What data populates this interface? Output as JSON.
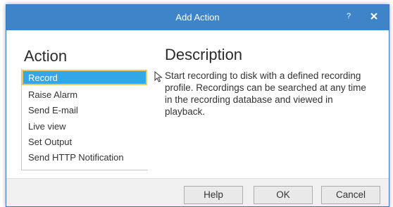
{
  "dialog": {
    "title": "Add Action",
    "help_label": "?",
    "close_icon": "close-icon"
  },
  "headings": {
    "action": "Action",
    "description": "Description"
  },
  "actions": [
    {
      "label": "Record",
      "selected": true
    },
    {
      "label": "Raise Alarm",
      "selected": false
    },
    {
      "label": "Send E-mail",
      "selected": false
    },
    {
      "label": "Live view",
      "selected": false
    },
    {
      "label": "Set Output",
      "selected": false
    },
    {
      "label": "Send HTTP Notification",
      "selected": false
    }
  ],
  "description_text": "Start recording to disk with a defined recording profile. Recordings can be searched at any time in the recording database and viewed in playback.",
  "buttons": {
    "help": "Help",
    "ok": "OK",
    "cancel": "Cancel"
  },
  "colors": {
    "titlebar": "#3f84c8",
    "selection": "#33a6e8",
    "selection_border": "#f0c85a"
  }
}
